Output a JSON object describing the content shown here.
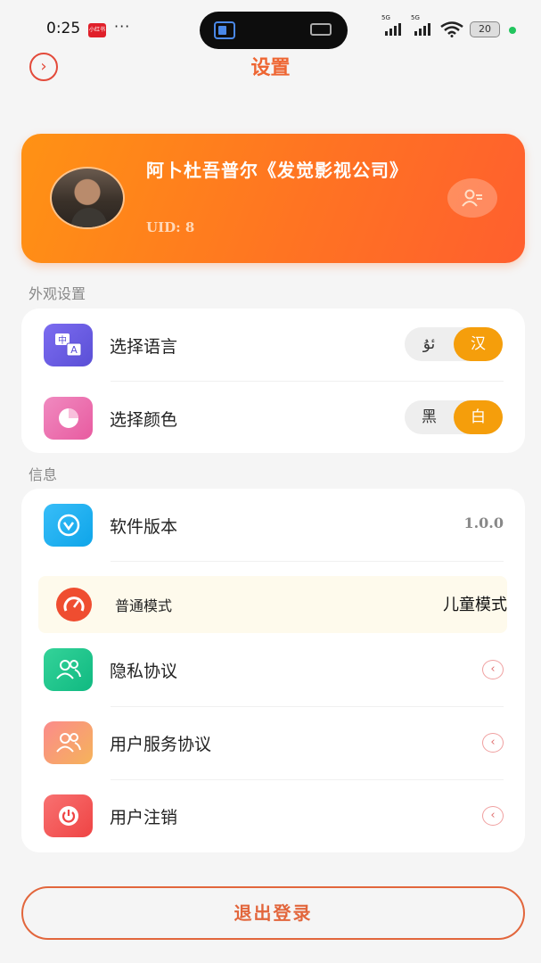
{
  "status_bar": {
    "time": "0:25",
    "app_badge": "小红书",
    "dots": "···",
    "signal1_label": "5G",
    "signal2_label": "5G",
    "battery": "20"
  },
  "header": {
    "title": "设置",
    "back_icon": "chevron-right-icon"
  },
  "profile": {
    "name": "阿卜杜吾普尔《发觉影视公司》",
    "uid": "UID: 8",
    "edit_icon": "user-edit-icon"
  },
  "appearance": {
    "section_label": "外观设置",
    "language": {
      "label": "选择语言",
      "icon": "translate-icon",
      "options": [
        "ئۇ",
        "汉"
      ],
      "selected": "汉"
    },
    "color": {
      "label": "选择颜色",
      "icon": "pie-chart-icon",
      "options": [
        "黑",
        "白"
      ],
      "selected": "白"
    }
  },
  "info": {
    "section_label": "信息",
    "version": {
      "label": "软件版本",
      "value": "1.0.0",
      "icon": "check-v-icon"
    },
    "mode": {
      "normal_label": "普通模式",
      "kids_label": "儿童模式",
      "icon": "speedometer-icon"
    },
    "privacy": {
      "label": "隐私协议",
      "icon": "users-icon"
    },
    "service": {
      "label": "用户服务协议",
      "icon": "users-icon"
    },
    "cancel_account": {
      "label": "用户注销",
      "icon": "power-icon"
    }
  },
  "logout_label": "退出登录",
  "colors": {
    "accent": "#ee6633",
    "toggle_on": "#f59e0b",
    "card_gradient_start": "#ff9214",
    "card_gradient_end": "#ff5f2e"
  }
}
